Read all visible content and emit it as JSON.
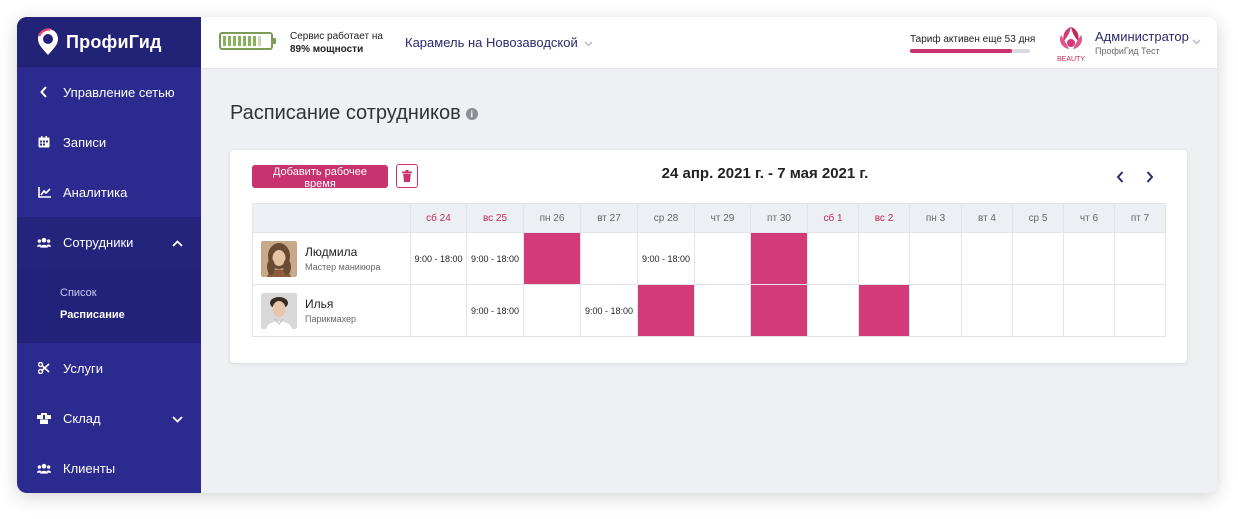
{
  "brand": {
    "name": "ПрофиГид"
  },
  "sidebar": {
    "items": [
      {
        "label": "Управление сетью",
        "icon": "chevron-left-icon"
      },
      {
        "label": "Записи",
        "icon": "calendar-icon"
      },
      {
        "label": "Аналитика",
        "icon": "chart-icon"
      },
      {
        "label": "Сотрудники",
        "icon": "users-icon"
      },
      {
        "label": "Услуги",
        "icon": "scissors-icon"
      },
      {
        "label": "Склад",
        "icon": "boxes-icon"
      },
      {
        "label": "Клиенты",
        "icon": "clients-icon"
      }
    ],
    "submenu": [
      {
        "label": "Список"
      },
      {
        "label": "Расписание"
      }
    ]
  },
  "header": {
    "service_text": "Сервис работает на",
    "service_percent": "89% мощности",
    "branch": "Карамель на Новозаводской",
    "tariff_text": "Тариф активен еще 53 дня",
    "tariff_progress": 0.85,
    "beauty_label": "BEAUTY",
    "user_name": "Администратор",
    "user_org": "ПрофиГид Тест"
  },
  "page": {
    "title": "Расписание сотрудников",
    "add_button": "Добавить рабочее время",
    "period": "24 апр. 2021 г. - 7 мая 2021 г."
  },
  "schedule": {
    "days": [
      {
        "label": "сб 24",
        "weekend": true
      },
      {
        "label": "вс 25",
        "weekend": true
      },
      {
        "label": "пн 26",
        "weekend": false
      },
      {
        "label": "вт 27",
        "weekend": false
      },
      {
        "label": "ср 28",
        "weekend": false
      },
      {
        "label": "чт 29",
        "weekend": false
      },
      {
        "label": "пт 30",
        "weekend": false
      },
      {
        "label": "сб 1",
        "weekend": true
      },
      {
        "label": "вс 2",
        "weekend": true
      },
      {
        "label": "пн 3",
        "weekend": false
      },
      {
        "label": "вт 4",
        "weekend": false
      },
      {
        "label": "ср 5",
        "weekend": false
      },
      {
        "label": "чт 6",
        "weekend": false
      },
      {
        "label": "пт 7",
        "weekend": false
      }
    ],
    "employees": [
      {
        "name": "Людмила",
        "role": "Мастер маникюра",
        "cells": [
          "9:00 - 18:00",
          "9:00 - 18:00",
          "#fill",
          "",
          "9:00 - 18:00",
          "",
          "#fill",
          "",
          "",
          "",
          "",
          "",
          "",
          ""
        ]
      },
      {
        "name": "Илья",
        "role": "Парикмахер",
        "cells": [
          "",
          "9:00 - 18:00",
          "",
          "9:00 - 18:00",
          "#fill",
          "",
          "#fill",
          "",
          "#fill",
          "",
          "",
          "",
          "",
          ""
        ]
      }
    ]
  },
  "colors": {
    "sidebar": "#2b2b8f",
    "accent": "#c8326f",
    "fill": "#d23b78",
    "battery": "#8bb05e"
  }
}
